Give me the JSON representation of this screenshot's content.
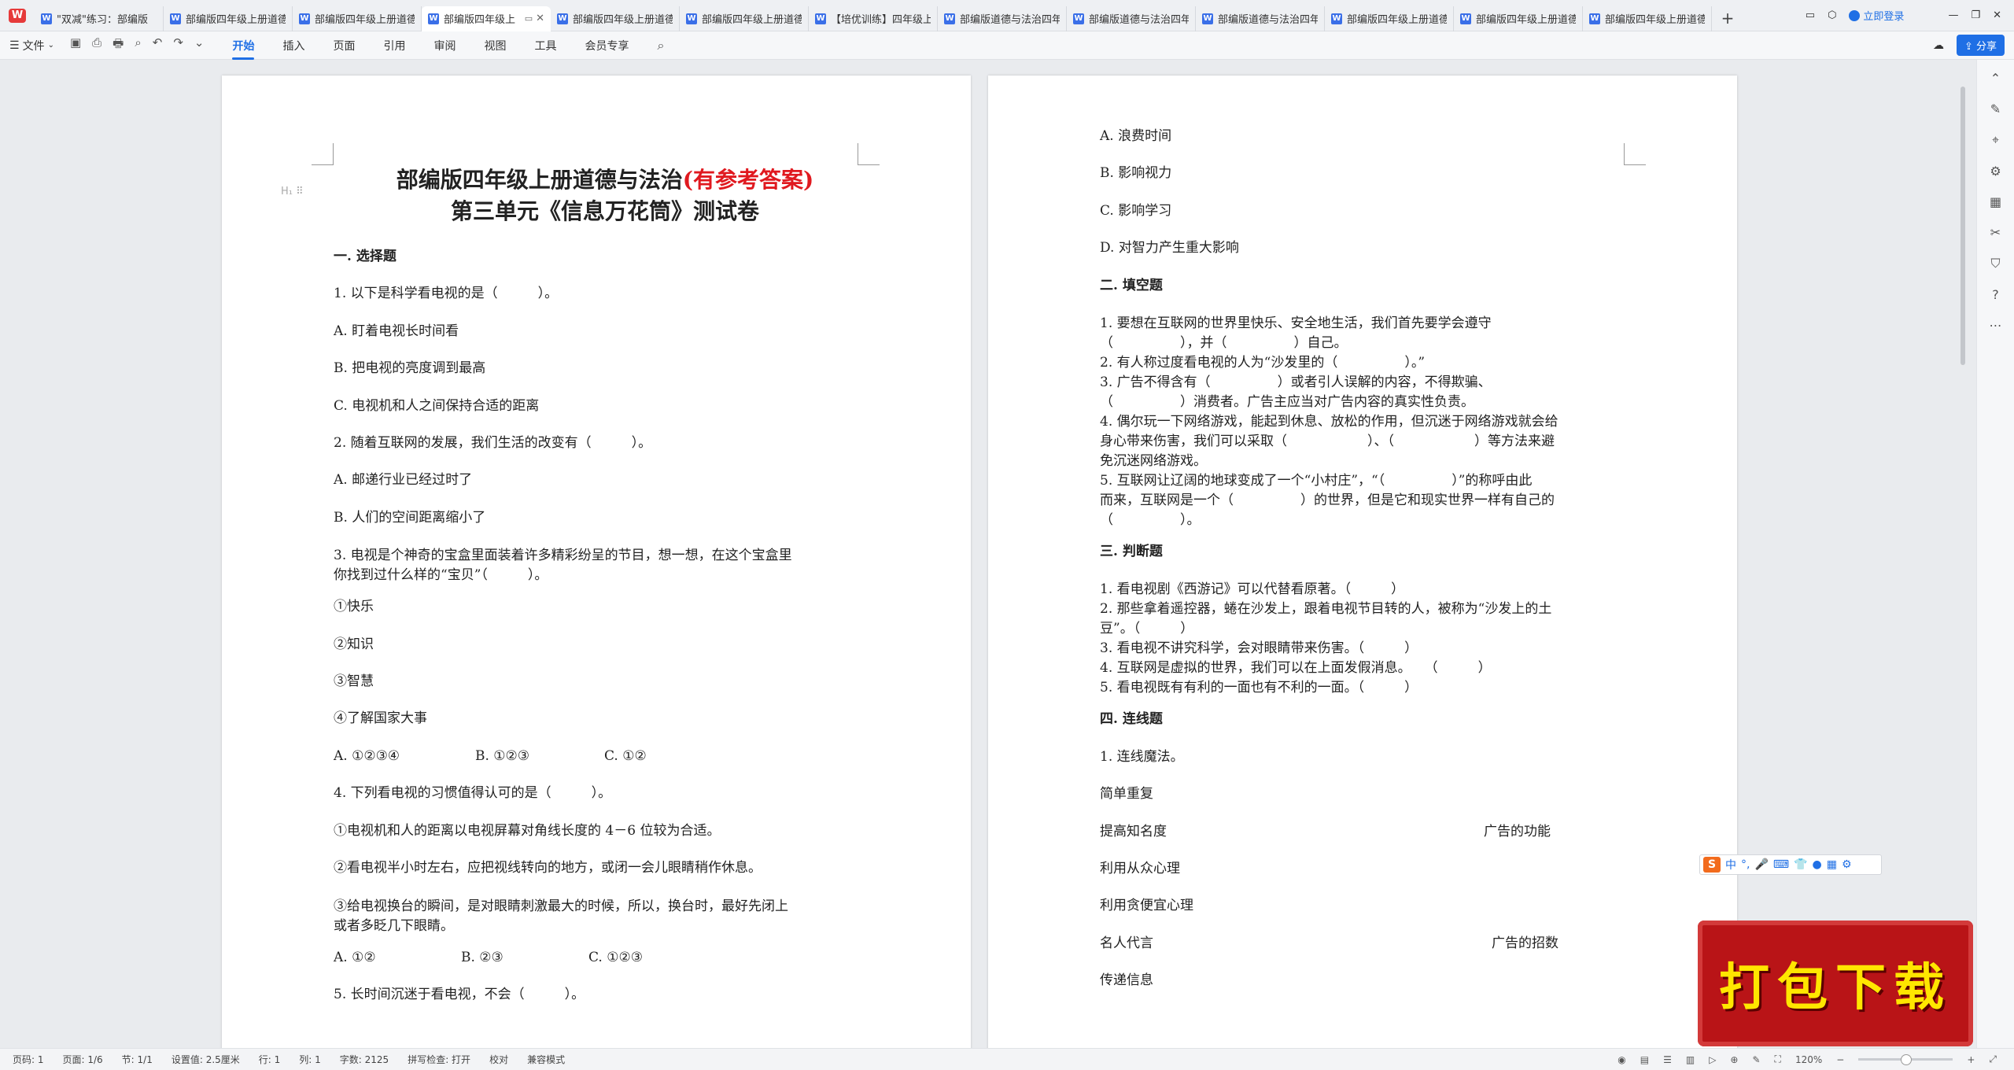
{
  "tabs": [
    {
      "label": "\"双减\"练习：部编版",
      "active": false
    },
    {
      "label": "部编版四年级上册道德",
      "active": false
    },
    {
      "label": "部编版四年级上册道德",
      "active": false
    },
    {
      "label": "部编版四年级上",
      "active": true
    },
    {
      "label": "部编版四年级上册道德",
      "active": false
    },
    {
      "label": "部编版四年级上册道德",
      "active": false
    },
    {
      "label": "【培优训练】四年级上",
      "active": false
    },
    {
      "label": "部编版道德与法治四年",
      "active": false
    },
    {
      "label": "部编版道德与法治四年",
      "active": false
    },
    {
      "label": "部编版道德与法治四年",
      "active": false
    },
    {
      "label": "部编版四年级上册道德",
      "active": false
    },
    {
      "label": "部编版四年级上册道德",
      "active": false
    },
    {
      "label": "部编版四年级上册道德",
      "active": false
    }
  ],
  "header": {
    "login_label": "立即登录",
    "share_label": "分享"
  },
  "ribbon": {
    "file_label": "文件",
    "tabs": [
      "开始",
      "插入",
      "页面",
      "引用",
      "审阅",
      "视图",
      "工具",
      "会员专享"
    ]
  },
  "doc": {
    "title_black": "部编版四年级上册道德与法治",
    "title_red": "(有参考答案)",
    "subtitle": "第三单元《信息万花筒》测试卷",
    "left": {
      "s1_heading": "一. 选择题",
      "q1": "1. 以下是科学看电视的是（　　　）。",
      "q1a": "A. 盯着电视长时间看",
      "q1b": "B. 把电视的亮度调到最高",
      "q1c": "C. 电视机和人之间保持合适的距离",
      "q2": "2. 随着互联网的发展，我们生活的改变有（　　　）。",
      "q2a": "A. 邮递行业已经过时了",
      "q2b": "B. 人们的空间距离缩小了",
      "q3_l1": "3. 电视是个神奇的宝盒里面装着许多精彩纷呈的节目，想一想，在这个宝盒里",
      "q3_l2": "你找到过什么样的“宝贝”（　　　）。",
      "q3_o1": "①快乐",
      "q3_o2": "②知识",
      "q3_o3": "③智慧",
      "q3_o4": "④了解国家大事",
      "q3_a": "A. ①②③④",
      "q3_b": "B. ①②③",
      "q3_c": "C. ①②",
      "q4": "4. 下列看电视的习惯值得认可的是（　　　）。",
      "q4_o1": "①电视机和人的距离以电视屏幕对角线长度的 4－6 位较为合适。",
      "q4_o2": "②看电视半小时左右，应把视线转向的地方，或闭一会儿眼睛稍作休息。",
      "q4_o3_l1": "③给电视换台的瞬间，是对眼睛刺激最大的时候，所以，换台时，最好先闭上",
      "q4_o3_l2": "或者多眨几下眼睛。",
      "q4_a": "A. ①②",
      "q4_b": "B. ②③",
      "q4_c": "C. ①②③",
      "q5": "5. 长时间沉迷于看电视，不会（　　　）。"
    },
    "right": {
      "q5a": "A. 浪费时间",
      "q5b": "B. 影响视力",
      "q5c": "C. 影响学习",
      "q5d": "D. 对智力产生重大影响",
      "s2_heading": "二. 填空题",
      "f1_l1": "1. 要想在互联网的世界里快乐、安全地生活，我们首先要学会遵守",
      "f1_l2": "（　　　　　），并（　　　　　）自己。",
      "f2": "2. 有人称过度看电视的人为“沙发里的（　　　　　）。”",
      "f3_l1": "3. 广告不得含有（　　　　　）或者引人误解的内容，不得欺骗、",
      "f3_l2": "（　　　　　）消费者。广告主应当对广告内容的真实性负责。",
      "f4_l1": "4. 偶尔玩一下网络游戏，能起到休息、放松的作用，但沉迷于网络游戏就会给",
      "f4_l2": "身心带来伤害，我们可以采取（　　　　　　）、（　　　　　　）等方法来避",
      "f4_l3": "免沉迷网络游戏。",
      "f5_l1": "5. 互联网让辽阔的地球变成了一个“小村庄”，“（　　　　　）”的称呼由此",
      "f5_l2": "而来，互联网是一个（　　　　　）的世界，但是它和现实世界一样有自己的",
      "f5_l3": "（　　　　　）。",
      "s3_heading": "三. 判断题",
      "j1": "1. 看电视剧《西游记》可以代替看原著。（　　　）",
      "j2_l1": "2. 那些拿着遥控器，蜷在沙发上，跟着电视节目转的人，被称为“沙发上的土",
      "j2_l2": "豆”。（　　　）",
      "j3": "3. 看电视不讲究科学，会对眼睛带来伤害。（　　　）",
      "j4": "4. 互联网是虚拟的世界，我们可以在上面发假消息。　　（　　　）",
      "j5": "5. 看电视既有有利的一面也有不利的一面。（　　　）",
      "s4_heading": "四. 连线题",
      "m1": "1. 连线魔法。",
      "m_l1": "简单重复",
      "m_l2": "提高知名度",
      "m_r2": "广告的功能",
      "m_l3": "利用从众心理",
      "m_l4": "利用贪便宜心理",
      "m_l5": "名人代言",
      "m_r5": "广告的招数",
      "m_l6": "传递信息"
    }
  },
  "ime": {
    "label": "中"
  },
  "download_banner": {
    "label": "打包下载"
  },
  "status": {
    "page": "页码: 1",
    "pages": "页面: 1/6",
    "section": "节: 1/1",
    "setting": "设置值: 2.5厘米",
    "row": "行: 1",
    "col": "列: 1",
    "words": "字数: 2125",
    "spell": "拼写检查: 打开",
    "proof": "校对",
    "compat": "兼容模式",
    "zoom": "120%"
  }
}
